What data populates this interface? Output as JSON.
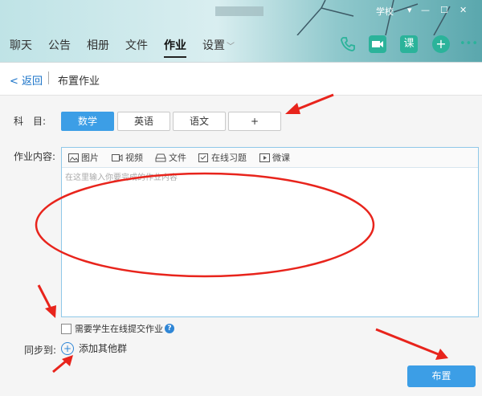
{
  "nav": {
    "tabs": [
      "聊天",
      "公告",
      "相册",
      "文件",
      "作业",
      "设置"
    ],
    "active_tab": "作业",
    "settings_caret": "﹀"
  },
  "window": {
    "user_label": "学校"
  },
  "header_icons": {
    "phone": "phone-icon",
    "video": "video-call-icon",
    "lesson": "课",
    "add": "+",
    "more": "•••"
  },
  "subbar": {
    "back_label": "返回",
    "title": "布置作业"
  },
  "form": {
    "subject_label": "科　目:",
    "subjects": [
      "数学",
      "英语",
      "语文",
      "+"
    ],
    "selected_subject": "数学",
    "content_label": "作业内容:",
    "toolbar": [
      "图片",
      "视频",
      "文件",
      "在线习题",
      "微课"
    ],
    "placeholder": "在这里输入你要完成的作业内容",
    "online_submit_label": "需要学生在线提交作业",
    "help_glyph": "?",
    "sync_label": "同步到:",
    "add_group_label": "添加其他群",
    "submit_label": "布置"
  },
  "colors": {
    "accent": "#3c9ee6",
    "annotation": "#e8241c",
    "header_green": "#2bb39a"
  }
}
